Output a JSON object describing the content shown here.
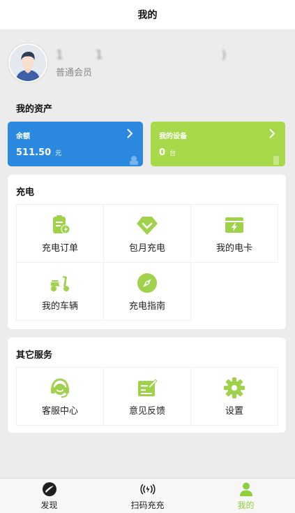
{
  "header": {
    "title": "我的"
  },
  "profile": {
    "name": "1    1               )",
    "level": "普通会员"
  },
  "assets": {
    "title": "我的资产",
    "balance": {
      "label": "余额",
      "value": "511.50",
      "unit": "元",
      "color": "#2b8ae0"
    },
    "devices": {
      "label": "我的设备",
      "value": "0",
      "unit": "台",
      "color": "#a8d94a"
    }
  },
  "charging": {
    "title": "充电",
    "items": [
      {
        "label": "充电订单",
        "icon": "charge-order-icon"
      },
      {
        "label": "包月充电",
        "icon": "monthly-charge-icon"
      },
      {
        "label": "我的电卡",
        "icon": "charge-card-icon"
      },
      {
        "label": "我的车辆",
        "icon": "scooter-icon"
      },
      {
        "label": "充电指南",
        "icon": "compass-icon"
      }
    ]
  },
  "services": {
    "title": "其它服务",
    "items": [
      {
        "label": "客服中心",
        "icon": "customer-service-icon"
      },
      {
        "label": "意见反馈",
        "icon": "feedback-icon"
      },
      {
        "label": "设置",
        "icon": "gear-icon"
      }
    ]
  },
  "tabbar": {
    "items": [
      {
        "label": "发现",
        "icon": "discover-icon"
      },
      {
        "label": "扫码充充",
        "icon": "scan-signal-icon"
      },
      {
        "label": "我的",
        "icon": "user-icon"
      }
    ],
    "active_color": "#8ccf3c"
  },
  "colors": {
    "accent_green": "#a8d94a",
    "blue": "#2b8ae0"
  }
}
